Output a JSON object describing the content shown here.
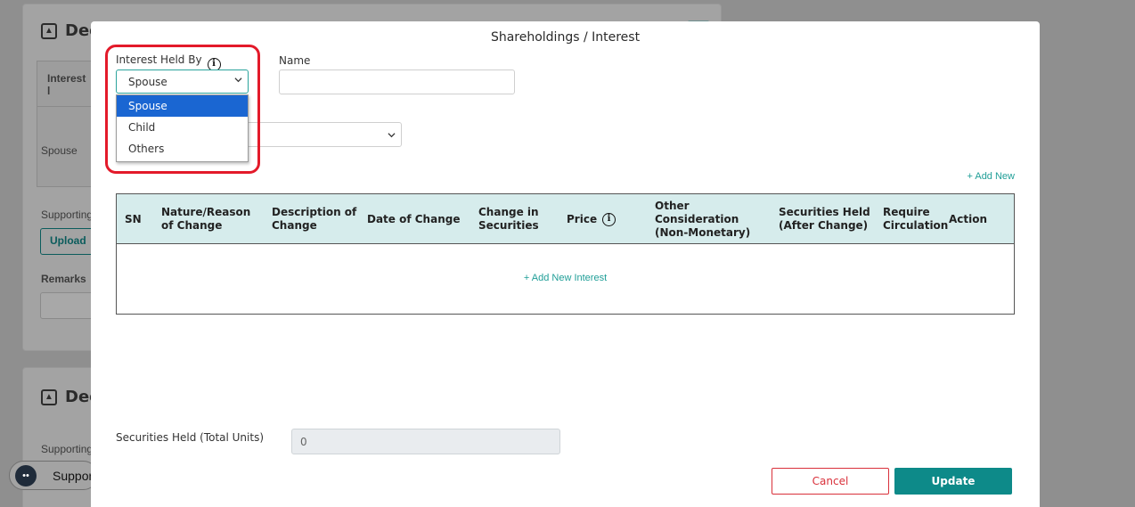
{
  "background": {
    "section1_title": "Dee",
    "interest_header": "Interest l",
    "spouse_text": "Spouse",
    "supporting_label": "Supporting",
    "upload_label": "Upload",
    "remarks_label": "Remarks",
    "section2_title": "Dee",
    "supporting_label_2": "Supporting",
    "support_widget_label": "Suppor"
  },
  "modal": {
    "title": "Shareholdings / Interest",
    "interest_held_by": {
      "label": "Interest Held By",
      "selected": "Spouse",
      "options": [
        "Spouse",
        "Child",
        "Others"
      ],
      "info_icon": "info-icon"
    },
    "name": {
      "label": "Name",
      "value": ""
    },
    "add_new_label": "+ Add New",
    "table": {
      "columns": [
        "SN",
        "Nature/Reason of Change",
        "Description of Change",
        "Date of Change",
        "Change in Securities",
        "Price",
        "Other Consideration (Non-Monetary)",
        "Securities Held (After Change)",
        "Require Circulation",
        "Action"
      ],
      "add_interest_label": "+ Add New Interest"
    },
    "securities_total": {
      "label": "Securities Held (Total Units)",
      "value": "0"
    },
    "buttons": {
      "cancel": "Cancel",
      "update": "Update"
    }
  },
  "colors": {
    "accent": "#0d8a89",
    "link": "#1f9e97",
    "danger": "#d9303a",
    "highlight": "#e31a2a",
    "selected_option": "#1a66d2",
    "table_header_bg": "#d6ecec"
  }
}
